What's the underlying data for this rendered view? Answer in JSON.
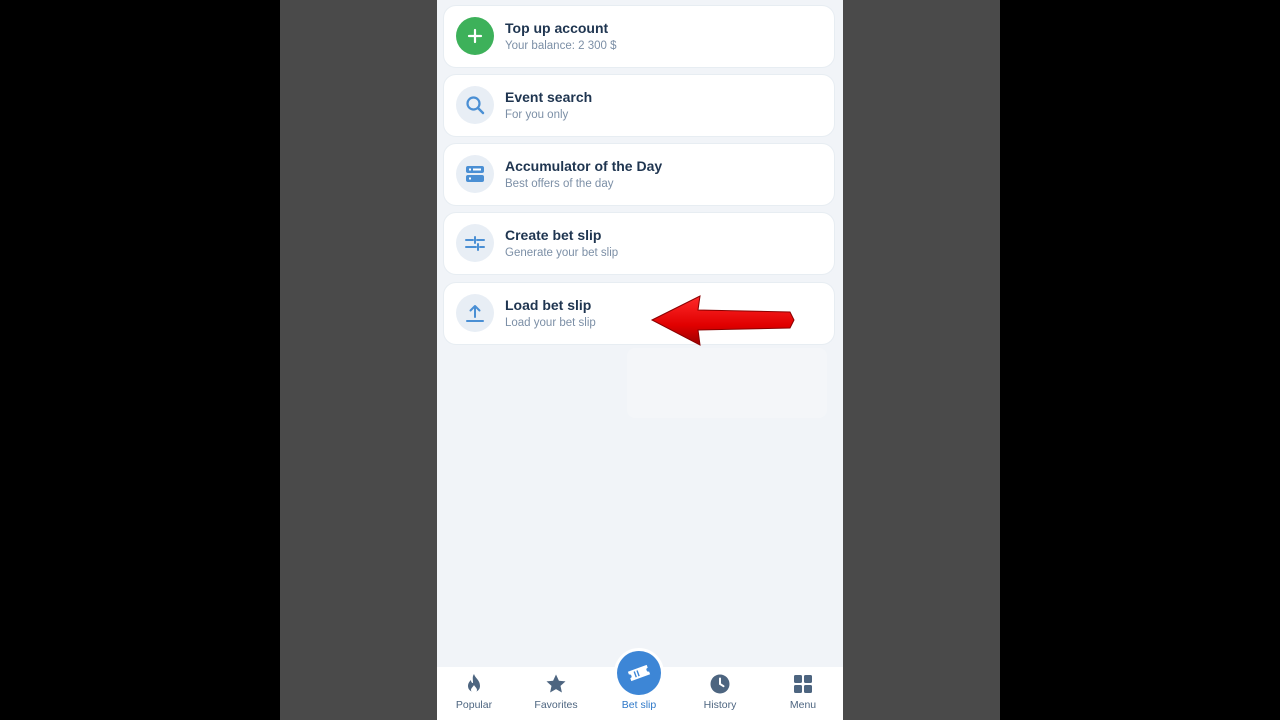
{
  "menu": {
    "items": [
      {
        "title": "Top up account",
        "subtitle": "Your balance: 2 300 $",
        "icon": "plus-icon"
      },
      {
        "title": "Event search",
        "subtitle": "For you only",
        "icon": "search-icon"
      },
      {
        "title": "Accumulator of the Day",
        "subtitle": "Best offers of the day",
        "icon": "accumulator-icon"
      },
      {
        "title": "Create bet slip",
        "subtitle": "Generate your bet slip",
        "icon": "sliders-icon"
      },
      {
        "title": "Load bet slip",
        "subtitle": "Load your bet slip",
        "icon": "upload-icon"
      }
    ]
  },
  "annotation": {
    "icon": "red-arrow-icon",
    "color": "#e00000"
  },
  "tabbar": {
    "tabs": [
      {
        "label": "Popular",
        "icon": "flame-icon"
      },
      {
        "label": "Favorites",
        "icon": "star-icon"
      },
      {
        "label": "Bet slip",
        "icon": "ticket-icon",
        "active": true
      },
      {
        "label": "History",
        "icon": "clock-icon"
      },
      {
        "label": "Menu",
        "icon": "grid-icon"
      }
    ]
  },
  "colors": {
    "accent": "#3d86d6",
    "green": "#3db15a",
    "title_text": "#1f3550",
    "subtitle_text": "#7c8fa6",
    "icon_blue": "#4a8fd4"
  }
}
